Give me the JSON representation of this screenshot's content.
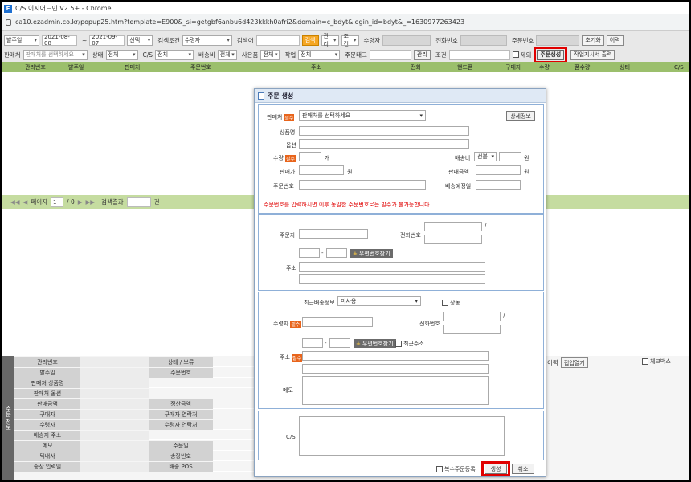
{
  "window": {
    "title": "C/S 이지어드민 V2.5+ - Chrome",
    "url": "ca10.ezadmin.co.kr/popup25.htm?template=E900&_si=getgbf6anbu6d423kkkh0afri2&domain=c_bdyt&login_id=bdyt&_=1630977263423"
  },
  "toolbar": {
    "date_type": "발주일",
    "date_from": "2021-08-08",
    "tilde": "~",
    "date_to": "2021-09-07",
    "select1": "선택",
    "search_cond_label": "검색조건",
    "search_cond": "수령자",
    "search_word_label": "검색어",
    "search_btn": "검색",
    "manage_sel": "관리",
    "cond_sel": "조건",
    "receiver_label": "수령자",
    "phone_label": "전화번호",
    "order_no_label": "주문번호",
    "reset_btn": "초기화",
    "history_btn": "이력",
    "seller_label": "판매처",
    "seller_placeholder": "판매처를 선택하세요",
    "status_label": "상태",
    "status_value": "전체",
    "cs_label": "C/S",
    "cs_value": "전체",
    "ship_fee_label": "배송비",
    "ship_fee_value": "전체",
    "private_label": "사은품",
    "private_value": "전체",
    "work_label": "작업",
    "work_value": "전체",
    "order_tag_label": "주문태그",
    "manage_btn": "관리",
    "cond_label": "조건",
    "except_label": "제외",
    "create_order_btn": "주문생성",
    "work_print_btn": "작업지시서 출력"
  },
  "grid": {
    "headers": [
      "관리번호",
      "발주일",
      "판매처",
      "주문번호",
      "주소",
      "전화",
      "핸드폰",
      "구매자",
      "수량",
      "품수량",
      "상태",
      "C/S"
    ]
  },
  "pager": {
    "page_label": "페이지",
    "page": "1",
    "slash_total": "/ 0",
    "search_result_label": "검색결과",
    "count_unit": "건"
  },
  "lower": {
    "side_label": "주문 정보",
    "rows": [
      {
        "k": "관리번호",
        "k2": "상태 / 보류"
      },
      {
        "k": "발주일",
        "k2": "주문번호"
      },
      {
        "k": "판매처 상품명",
        "k2": ""
      },
      {
        "k": "판매처 옵션",
        "k2": ""
      },
      {
        "k": "판매금액",
        "k2": "정산금액"
      },
      {
        "k": "구매자",
        "k2": "구매자 연락처"
      },
      {
        "k": "수령자",
        "k2": "수령자 연락처"
      },
      {
        "k": "배송지 주소",
        "k2": ""
      },
      {
        "k": "메모",
        "k2": "주문일"
      },
      {
        "k": "택배사",
        "k2": "송장번호"
      },
      {
        "k": "송장 입력일",
        "k2": "배송 POS"
      }
    ],
    "right_history": "이력",
    "right_open_btn": "접업열기",
    "right_check": "체크박스"
  },
  "modal": {
    "title": "주문 생성",
    "seller_label": "판매처",
    "seller_select": "판매처를 선택하세요",
    "detail_btn": "상세정보",
    "product_label": "상품명",
    "option_label": "옵션",
    "qty_label": "수량",
    "qty_unit": "개",
    "ship_fee_label": "배송비",
    "ship_fee_select": "선불",
    "won": "원",
    "price_label": "판매가",
    "sale_amount_label": "판매금액",
    "order_no_label": "주문번호",
    "ship_date_label": "배송예정일",
    "notice": "주문번호를 입력하시면 이후 동일한 주문번호로는 발주가 불가능합니다.",
    "orderer_label": "주문자",
    "phone_label": "전화번호",
    "zip_btn": "우편번호찾기",
    "address_label": "주소",
    "recent_ship_label": "최근배송정보",
    "recent_ship_select": "미사용",
    "same_label": "상동",
    "receiver_label": "수령자",
    "receiver_phone_label": "전화번호",
    "recent_addr_label": "최근주소",
    "memo_label": "메모",
    "cs_label": "C/S",
    "multi_order_label": "복수주문등록",
    "create_btn": "생성",
    "cancel_btn": "취소",
    "required": "필수",
    "dash": "-",
    "slash": "/"
  }
}
